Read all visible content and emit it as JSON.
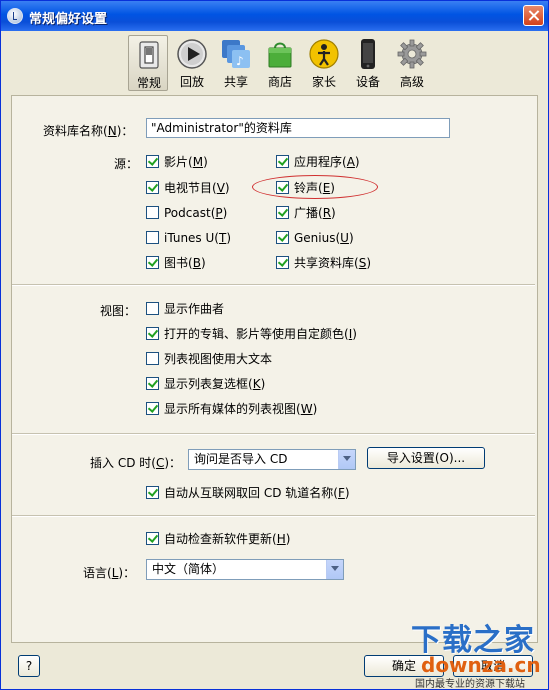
{
  "window": {
    "title": "常规偏好设置"
  },
  "toolbar": {
    "tabs": [
      {
        "label": "常规",
        "icon": "switch-icon",
        "active": true
      },
      {
        "label": "回放",
        "icon": "play-icon",
        "active": false
      },
      {
        "label": "共享",
        "icon": "share-icon",
        "active": false
      },
      {
        "label": "商店",
        "icon": "store-bag-icon",
        "active": false
      },
      {
        "label": "家长",
        "icon": "parental-icon",
        "active": false
      },
      {
        "label": "设备",
        "icon": "iphone-icon",
        "active": false
      },
      {
        "label": "高级",
        "icon": "gear-icon",
        "active": false
      }
    ]
  },
  "library": {
    "label": "资料库名称",
    "mnemonic": "N",
    "value": "\"Administrator\"的资料库"
  },
  "sources": {
    "label": "源：",
    "items": [
      {
        "label": "影片",
        "mnemonic": "M",
        "checked": true
      },
      {
        "label": "应用程序",
        "mnemonic": "A",
        "checked": true
      },
      {
        "label": "电视节目",
        "mnemonic": "V",
        "checked": true
      },
      {
        "label": "铃声",
        "mnemonic": "E",
        "checked": true
      },
      {
        "label": "Podcast",
        "mnemonic": "P",
        "checked": false
      },
      {
        "label": "广播",
        "mnemonic": "R",
        "checked": true
      },
      {
        "label": "iTunes U",
        "mnemonic": "T",
        "checked": false
      },
      {
        "label": "Genius",
        "mnemonic": "U",
        "checked": true
      },
      {
        "label": "图书",
        "mnemonic": "B",
        "checked": true
      },
      {
        "label": "共享资料库",
        "mnemonic": "S",
        "checked": true
      }
    ]
  },
  "views": {
    "label": "视图：",
    "items": [
      {
        "label": "显示作曲者",
        "mnemonic": "",
        "checked": false
      },
      {
        "label": "打开的专辑、影片等使用自定颜色",
        "mnemonic": "I",
        "checked": true
      },
      {
        "label": "列表视图使用大文本",
        "mnemonic": "",
        "checked": false
      },
      {
        "label": "显示列表复选框",
        "mnemonic": "K",
        "checked": true
      },
      {
        "label": "显示所有媒体的列表视图",
        "mnemonic": "W",
        "checked": true
      }
    ]
  },
  "cd": {
    "label": "插入 CD 时",
    "mnemonic": "C",
    "selected": "询问是否导入 CD",
    "import_button": "导入设置(O)...",
    "auto_fetch": {
      "label": "自动从互联网取回 CD 轨道名称",
      "mnemonic": "F",
      "checked": true
    }
  },
  "updates": {
    "label": "自动检查新软件更新",
    "mnemonic": "H",
    "checked": true
  },
  "language": {
    "label": "语言",
    "mnemonic": "L",
    "selected": "中文（简体）"
  },
  "footer": {
    "help": "?",
    "ok": "确定",
    "cancel": "取消"
  },
  "watermark": {
    "title": "下载之家",
    "domain": "downza.cn",
    "tagline": "国内最专业的资源下载站"
  },
  "colors": {
    "titlebar": "#0054e3",
    "panel": "#f4f2e8",
    "annotation": "#d03030"
  }
}
